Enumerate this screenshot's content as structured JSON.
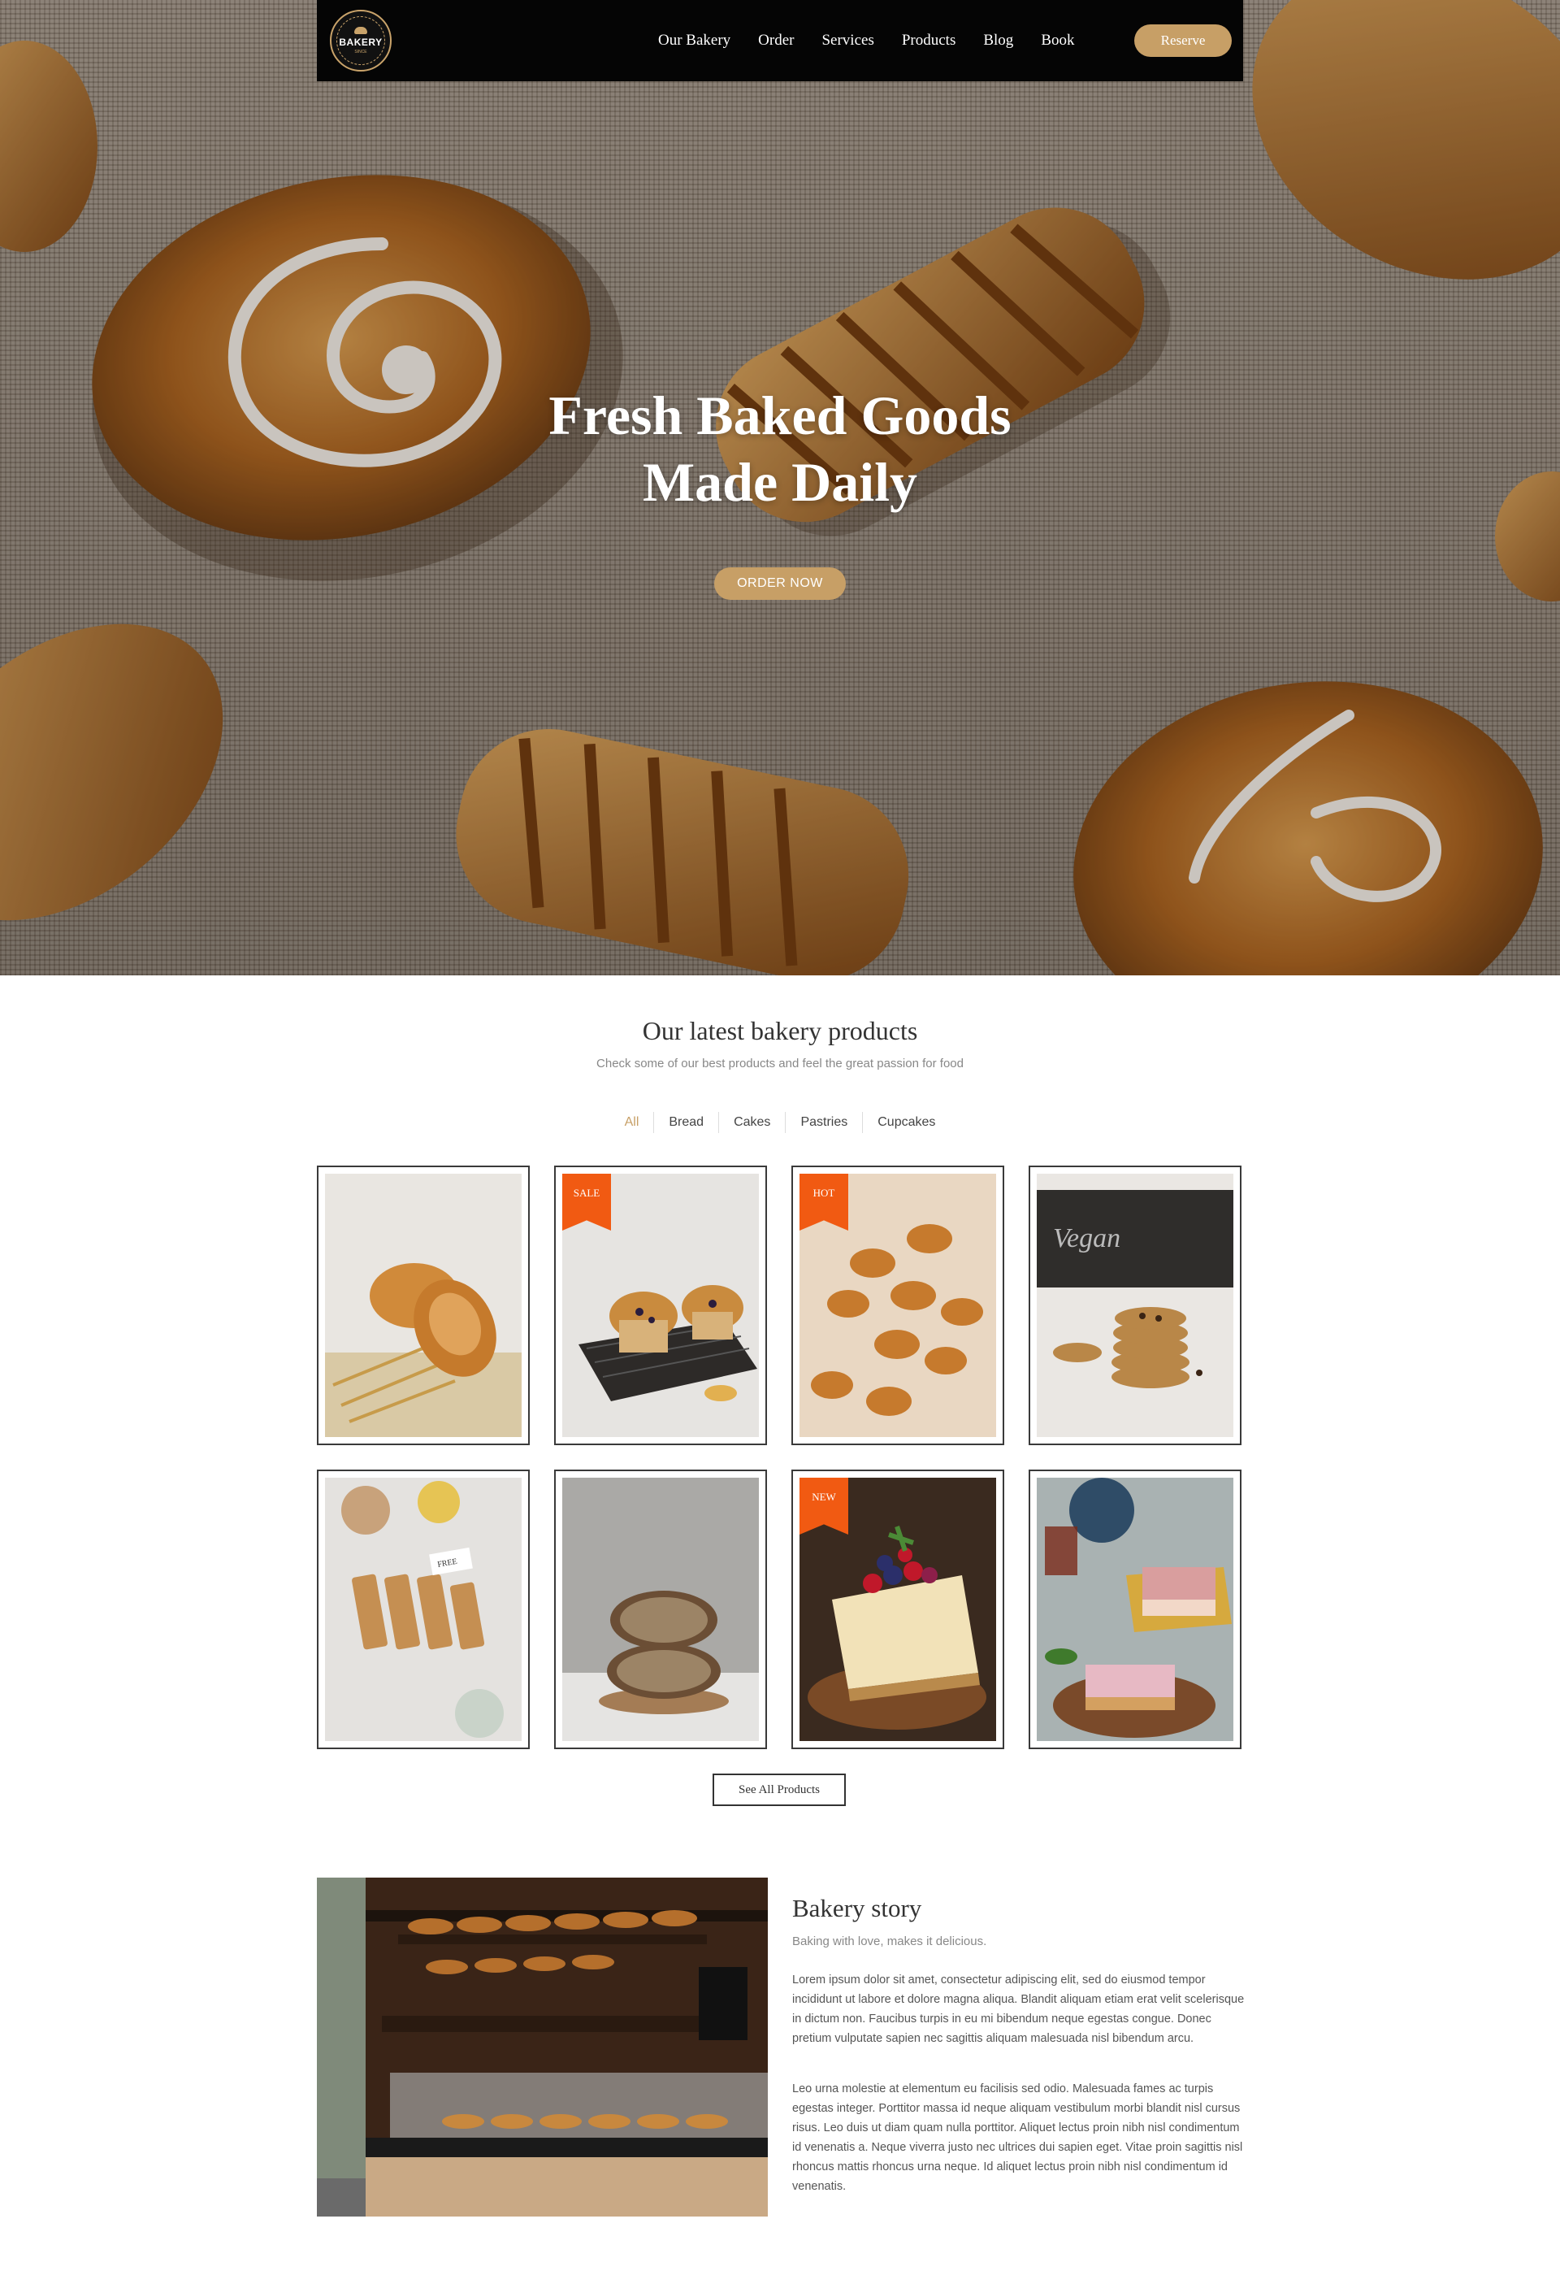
{
  "nav": {
    "logo_text": "BAKERY",
    "logo_since": "SINCE",
    "items": [
      "Our Bakery",
      "Order",
      "Services",
      "Products",
      "Blog",
      "Book"
    ],
    "reserve_label": "Reserve"
  },
  "hero": {
    "title_line1": "Fresh Baked Goods",
    "title_line2": "Made Daily",
    "cta_label": "ORDER NOW"
  },
  "products": {
    "title": "Our latest bakery products",
    "subtitle": "Check some of our best products and feel the great passion for food",
    "filters": [
      "All",
      "Bread",
      "Cakes",
      "Pastries",
      "Cupcakes"
    ],
    "active_filter": "All",
    "items": [
      {
        "image": "bread-rolls-with-wheat",
        "badge": ""
      },
      {
        "image": "blueberry-muffins-on-rack",
        "badge": "SALE"
      },
      {
        "image": "mini-croissants",
        "badge": "HOT"
      },
      {
        "image": "chocolate-chip-cookies",
        "badge": ""
      },
      {
        "image": "granola-bars",
        "badge": ""
      },
      {
        "image": "sourdough-loaf-halves",
        "badge": ""
      },
      {
        "image": "berry-cheesecake",
        "badge": "NEW"
      },
      {
        "image": "layered-cake-slices-with-tea",
        "badge": ""
      }
    ],
    "see_all_label": "See All Products"
  },
  "story": {
    "image": "bakery-shop-interior",
    "title": "Bakery story",
    "subtitle": "Baking with love, makes it delicious.",
    "paragraph1": "Lorem ipsum dolor sit amet, consectetur adipiscing elit, sed do eiusmod tempor incididunt ut labore et dolore magna aliqua. Blandit aliquam etiam erat velit scelerisque in dictum non. Faucibus turpis in eu mi bibendum neque egestas congue. Donec pretium vulputate sapien nec sagittis aliquam malesuada nisl bibendum arcu.",
    "paragraph2": "Leo urna molestie at elementum eu facilisis sed odio. Malesuada fames ac turpis egestas integer. Porttitor massa id neque aliquam vestibulum morbi blandit nisl cursus risus. Leo duis ut diam quam nulla porttitor. Aliquet lectus proin nibh nisl condimentum id venenatis a. Neque viverra justo nec ultrices dui sapien eget. Vitae proin sagittis nisl rhoncus mattis rhoncus urna neque. Id aliquet lectus proin nibh nisl condimentum id venenatis."
  },
  "colors": {
    "accent": "#c79f66",
    "badge": "#f15a12",
    "nav_bg": "#050505"
  }
}
